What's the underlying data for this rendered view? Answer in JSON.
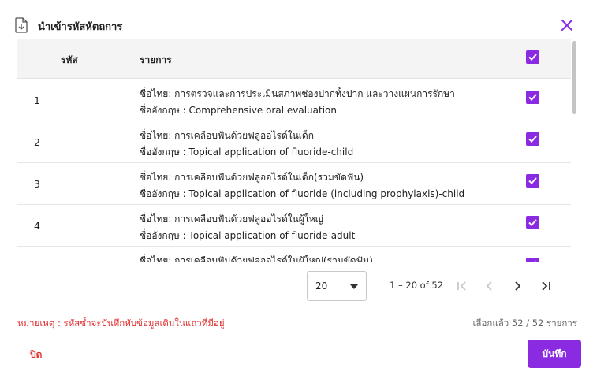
{
  "dialog": {
    "title": "นำเข้ารหัสหัตถการ",
    "icons": {
      "doc": "document-import-icon",
      "close": "close-icon"
    }
  },
  "table": {
    "headers": {
      "code": "รหัส",
      "item": "รายการ"
    },
    "header_checked": true,
    "rows": [
      {
        "code": "1",
        "th": "ชื่อไทย: การตรวจและการประเมินสภาพช่องปากทั้งปาก และวางแผนการรักษา",
        "en": "ชื่ออังกฤษ : Comprehensive oral evaluation",
        "checked": true
      },
      {
        "code": "2",
        "th": "ชื่อไทย: การเคลือบฟันด้วยฟลูออไรด์ในเด็ก",
        "en": "ชื่ออังกฤษ : Topical application of fluoride-child",
        "checked": true
      },
      {
        "code": "3",
        "th": "ชื่อไทย: การเคลือบฟันด้วยฟลูออไรด์ในเด็ก(รวมขัดฟัน)",
        "en": "ชื่ออังกฤษ : Topical application of fluoride (including prophylaxis)-child",
        "checked": true
      },
      {
        "code": "4",
        "th": "ชื่อไทย: การเคลือบฟันด้วยฟลูออไรด์ในผู้ใหญ่",
        "en": "ชื่ออังกฤษ : Topical application of fluoride-adult",
        "checked": true
      },
      {
        "code": "",
        "th": "ชื่อไทย: การเคลือบฟันด้วยฟลูออไรด์ในผู้ใหญ่(รวมขัดฟัน)",
        "en": "",
        "checked": true
      }
    ]
  },
  "pagination": {
    "page_size": "20",
    "range_label": "1 – 20 of 52"
  },
  "footer": {
    "note": "หมายเหตุ : รหัสซ้ำจะบันทึกทับข้อมูลเดิมในแถวที่มีอยู่",
    "selected_label": "เลือกแล้ว 52 / 52 รายการ",
    "close_label": "ปิด",
    "save_label": "บันทึก"
  },
  "colors": {
    "accent": "#8a2be2",
    "danger": "#e03131"
  }
}
